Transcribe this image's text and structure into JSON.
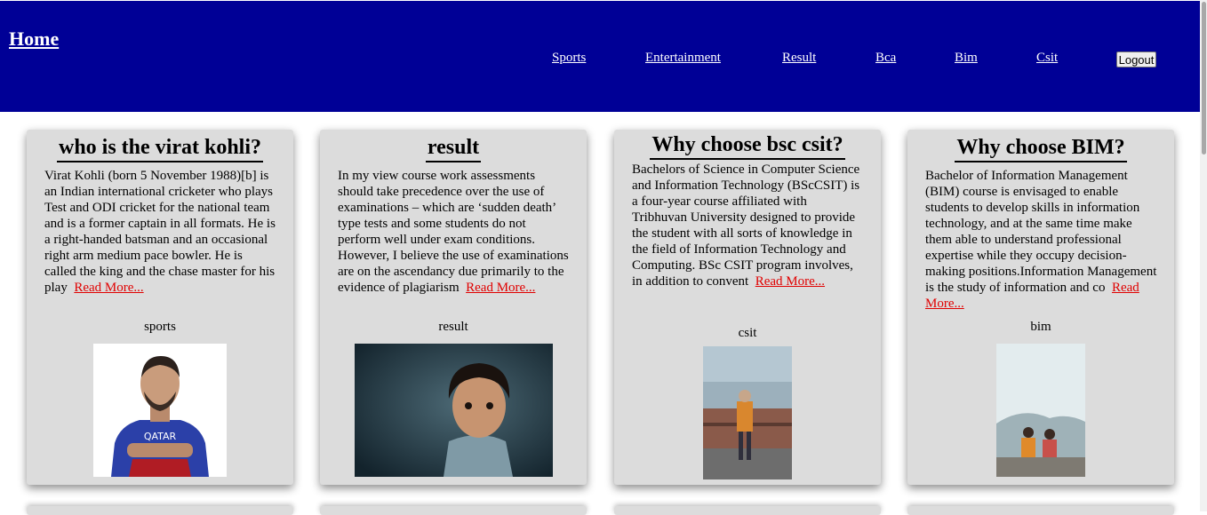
{
  "header": {
    "home_label": "Home",
    "nav": [
      "Sports",
      "Entertainment",
      "Result",
      "Bca",
      "Bim",
      "Csit"
    ],
    "logout_label": "Logout",
    "bg_color": "#000096"
  },
  "cards": [
    {
      "title": "who is the virat kohli?",
      "text": "Virat Kohli (born 5 November 1988)[b] is an Indian international cricketer who plays Test and ODI cricket for the national team and is a former captain in all formats. He is a right-handed batsman and an occasional right arm medium pace bowler. He is called the king and the chase master for his play",
      "read_more": "Read More...",
      "category": "sports"
    },
    {
      "title": "result",
      "text": "In my view course work assessments should take precedence over the use of examinations – which are ‘sudden death’ type tests and some students do not perform well under exam conditions. However, I believe the use of examinations are on the ascendancy due primarily to the evidence of plagiarism",
      "read_more": "Read More...",
      "category": "result"
    },
    {
      "title": "Why choose bsc csit?",
      "text": "Bachelors of Science in Computer Science and Information Technology (BScCSIT) is a four-year course affiliated with Tribhuvan University designed to provide the student with all sorts of knowledge in the field of Information Technology and Computing. BSc CSIT program involves, in addition to convent",
      "read_more": "Read More...",
      "category": "csit"
    },
    {
      "title": "Why choose BIM?",
      "text": "Bachelor of Information Management (BIM) course is envisaged to enable students to develop skills in information technology, and at the same time make them able to understand professional expertise while they occupy decision-making positions.Information Management is the study of information and co",
      "read_more": "Read More...",
      "category": "bim"
    }
  ]
}
